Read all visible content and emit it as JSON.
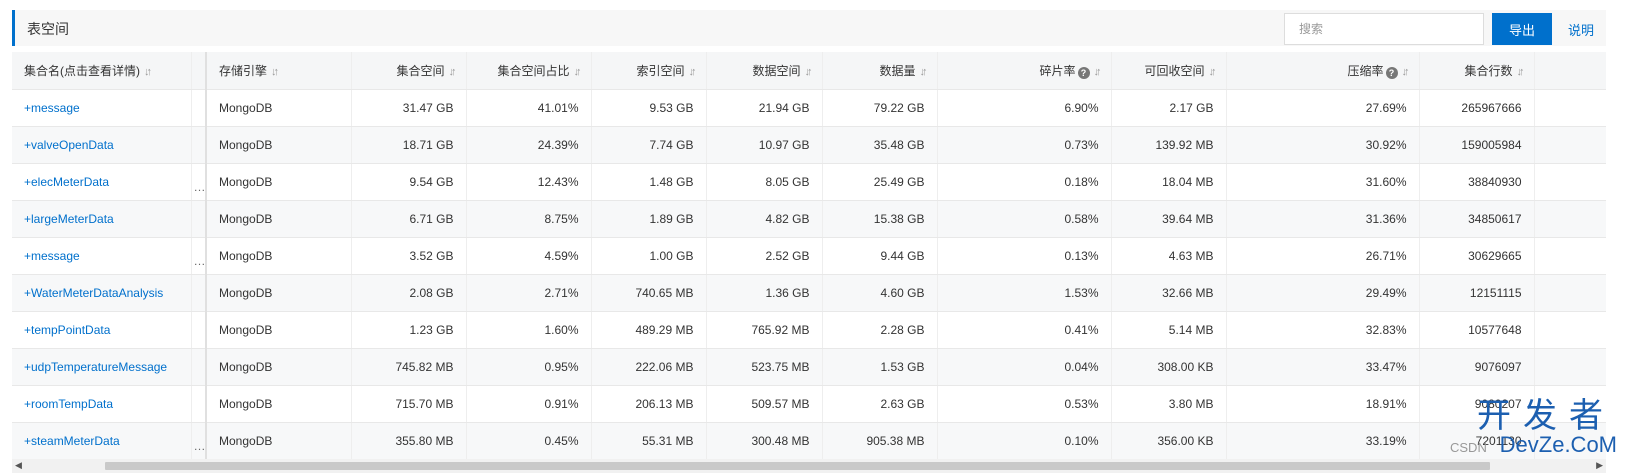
{
  "header": {
    "title": "表空间",
    "search_placeholder": "搜索",
    "export_label": "导出",
    "help_label": "说明"
  },
  "table": {
    "columns": {
      "name": "集合名(点击查看详情)",
      "engine": "存储引擎",
      "coll_space": "集合空间",
      "coll_ratio": "集合空间占比",
      "index_space": "索引空间",
      "data_space": "数据空间",
      "data_amount": "数据量",
      "frag_rate": "碎片率",
      "reclaim": "可回收空间",
      "compress": "压缩率",
      "rows": "集合行数"
    },
    "sort_icon": "sort-arrows-icon",
    "ellipsis": "…",
    "rows": [
      {
        "name": "+message",
        "engine": "MongoDB",
        "coll_space": "31.47 GB",
        "coll_ratio": "41.01%",
        "index_space": "9.53 GB",
        "data_space": "21.94 GB",
        "data_amount": "79.22 GB",
        "frag_rate": "6.90%",
        "reclaim": "2.17 GB",
        "compress": "27.69%",
        "rows": "265967666",
        "ellipsis": ""
      },
      {
        "name": "+valveOpenData",
        "engine": "MongoDB",
        "coll_space": "18.71 GB",
        "coll_ratio": "24.39%",
        "index_space": "7.74 GB",
        "data_space": "10.97 GB",
        "data_amount": "35.48 GB",
        "frag_rate": "0.73%",
        "reclaim": "139.92 MB",
        "compress": "30.92%",
        "rows": "159005984",
        "ellipsis": ""
      },
      {
        "name": "+elecMeterData",
        "engine": "MongoDB",
        "coll_space": "9.54 GB",
        "coll_ratio": "12.43%",
        "index_space": "1.48 GB",
        "data_space": "8.05 GB",
        "data_amount": "25.49 GB",
        "frag_rate": "0.18%",
        "reclaim": "18.04 MB",
        "compress": "31.60%",
        "rows": "38840930",
        "ellipsis": "…"
      },
      {
        "name": "+largeMeterData",
        "engine": "MongoDB",
        "coll_space": "6.71 GB",
        "coll_ratio": "8.75%",
        "index_space": "1.89 GB",
        "data_space": "4.82 GB",
        "data_amount": "15.38 GB",
        "frag_rate": "0.58%",
        "reclaim": "39.64 MB",
        "compress": "31.36%",
        "rows": "34850617",
        "ellipsis": ""
      },
      {
        "name": "+message",
        "engine": "MongoDB",
        "coll_space": "3.52 GB",
        "coll_ratio": "4.59%",
        "index_space": "1.00 GB",
        "data_space": "2.52 GB",
        "data_amount": "9.44 GB",
        "frag_rate": "0.13%",
        "reclaim": "4.63 MB",
        "compress": "26.71%",
        "rows": "30629665",
        "ellipsis": "…"
      },
      {
        "name": "+WaterMeterDataAnalysis",
        "engine": "MongoDB",
        "coll_space": "2.08 GB",
        "coll_ratio": "2.71%",
        "index_space": "740.65 MB",
        "data_space": "1.36 GB",
        "data_amount": "4.60 GB",
        "frag_rate": "1.53%",
        "reclaim": "32.66 MB",
        "compress": "29.49%",
        "rows": "12151115",
        "ellipsis": ""
      },
      {
        "name": "+tempPointData",
        "engine": "MongoDB",
        "coll_space": "1.23 GB",
        "coll_ratio": "1.60%",
        "index_space": "489.29 MB",
        "data_space": "765.92 MB",
        "data_amount": "2.28 GB",
        "frag_rate": "0.41%",
        "reclaim": "5.14 MB",
        "compress": "32.83%",
        "rows": "10577648",
        "ellipsis": ""
      },
      {
        "name": "+udpTemperatureMessage",
        "engine": "MongoDB",
        "coll_space": "745.82 MB",
        "coll_ratio": "0.95%",
        "index_space": "222.06 MB",
        "data_space": "523.75 MB",
        "data_amount": "1.53 GB",
        "frag_rate": "0.04%",
        "reclaim": "308.00 KB",
        "compress": "33.47%",
        "rows": "9076097",
        "ellipsis": ""
      },
      {
        "name": "+roomTempData",
        "engine": "MongoDB",
        "coll_space": "715.70 MB",
        "coll_ratio": "0.91%",
        "index_space": "206.13 MB",
        "data_space": "509.57 MB",
        "data_amount": "2.63 GB",
        "frag_rate": "0.53%",
        "reclaim": "3.80 MB",
        "compress": "18.91%",
        "rows": "9080207",
        "ellipsis": ""
      },
      {
        "name": "+steamMeterData",
        "engine": "MongoDB",
        "coll_space": "355.80 MB",
        "coll_ratio": "0.45%",
        "index_space": "55.31 MB",
        "data_space": "300.48 MB",
        "data_amount": "905.38 MB",
        "frag_rate": "0.10%",
        "reclaim": "356.00 KB",
        "compress": "33.19%",
        "rows": "7201130",
        "ellipsis": "…"
      }
    ]
  },
  "watermark": {
    "big": "开发者",
    "small": "DevZe.CoM",
    "csdn": "CSDN"
  },
  "colors": {
    "accent": "#0070cc",
    "header_bg": "#f7f7f7",
    "row_alt": "#f7f8f9"
  }
}
